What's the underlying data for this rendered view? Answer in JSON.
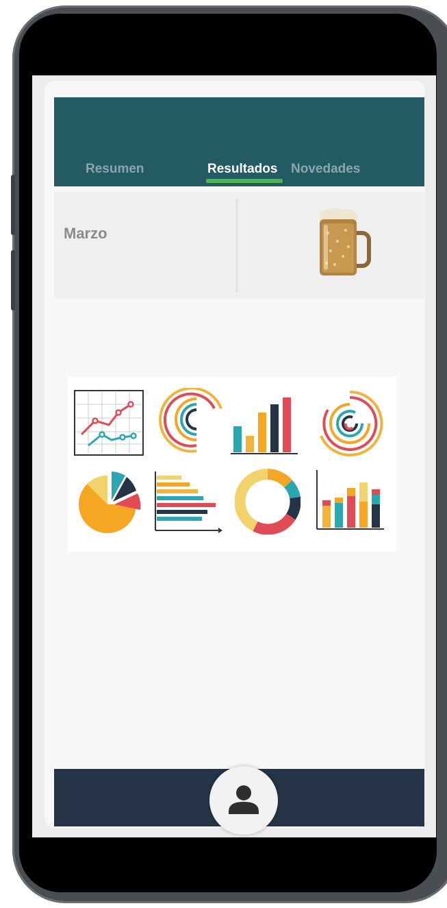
{
  "tabs": [
    {
      "label": "Resumen"
    },
    {
      "label": "Resultados"
    },
    {
      "label": "Novedades"
    }
  ],
  "active_tab": "Resultados",
  "info": {
    "month": "Marzo",
    "product_icon": "beer-mug-icon"
  },
  "charts_icons": [
    "line-chart-icon",
    "radial-bars-icon",
    "bar-chart-icon",
    "concentric-rings-icon",
    "pie-chart-icon",
    "horizontal-bar-chart-icon",
    "donut-chart-icon",
    "stacked-bar-chart-icon"
  ],
  "bottom_nav": {
    "profile_icon": "user-icon"
  },
  "colors": {
    "header": "#245a63",
    "tab_indicator": "#4cb550",
    "bottom_nav": "#263447",
    "frame": "#4a4d52"
  }
}
